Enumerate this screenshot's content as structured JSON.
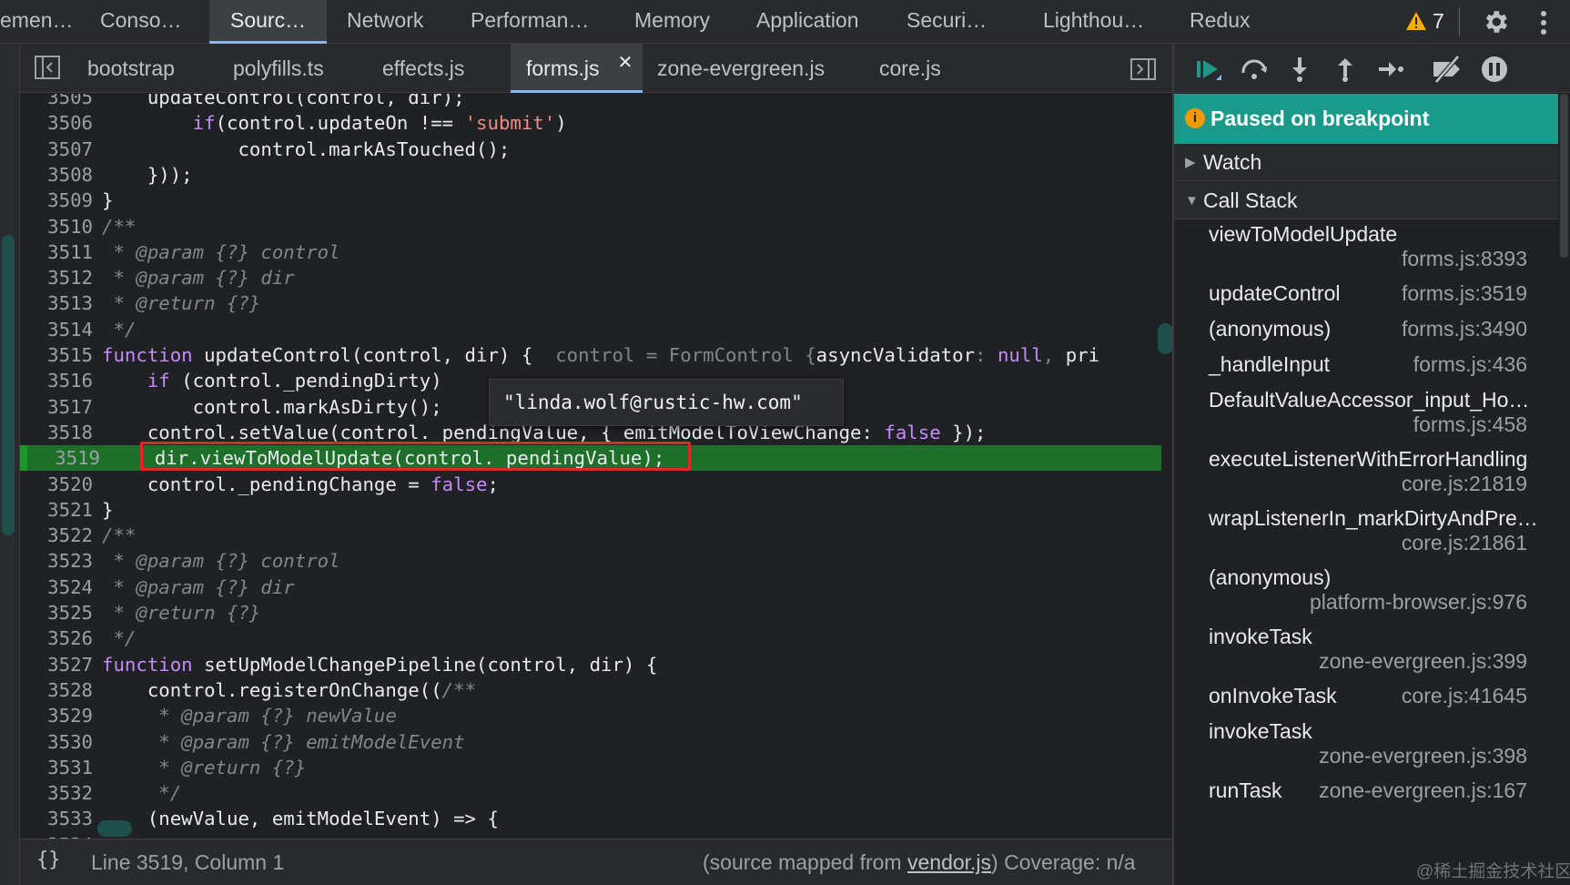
{
  "top_tabs": [
    "emen…",
    "Conso…",
    "Sourc…",
    "Network",
    "Performan…",
    "Memory",
    "Application",
    "Securi…",
    "Lighthou…",
    "Redux"
  ],
  "active_top_tab": "Sourc…",
  "warnings_count": "7",
  "file_tabs": [
    "bootstrap",
    "polyfills.ts",
    "effects.js",
    "forms.js",
    "zone-evergreen.js",
    "core.js"
  ],
  "active_file": "forms.js",
  "code_lines": [
    {
      "n": "3505",
      "tokens": [
        [
          "",
          "    updateControl(control, dir);"
        ]
      ]
    },
    {
      "n": "3506",
      "tokens": [
        [
          "kw",
          "        if"
        ],
        [
          "",
          "(control.updateOn !== "
        ],
        [
          "str",
          "'submit'"
        ],
        [
          "",
          ")"
        ]
      ]
    },
    {
      "n": "3507",
      "tokens": [
        [
          "",
          "            control.markAsTouched();"
        ]
      ]
    },
    {
      "n": "3508",
      "tokens": [
        [
          "",
          "    }));"
        ]
      ]
    },
    {
      "n": "3509",
      "tokens": [
        [
          "",
          "}"
        ]
      ]
    },
    {
      "n": "3510",
      "tokens": [
        [
          "cm",
          "/**"
        ]
      ]
    },
    {
      "n": "3511",
      "tokens": [
        [
          "cm",
          " * @param {?} control"
        ]
      ]
    },
    {
      "n": "3512",
      "tokens": [
        [
          "cm",
          " * @param {?} dir"
        ]
      ]
    },
    {
      "n": "3513",
      "tokens": [
        [
          "cm",
          " * @return {?}"
        ]
      ]
    },
    {
      "n": "3514",
      "tokens": [
        [
          "cm",
          " */"
        ]
      ]
    },
    {
      "n": "3515",
      "tokens": [
        [
          "kw",
          "function"
        ],
        [
          "",
          " updateControl(control, dir) {  "
        ],
        [
          "inl",
          "control = FormControl {"
        ],
        [
          "",
          "asyncValidator"
        ],
        [
          "inl",
          ": "
        ],
        [
          "inv",
          "null"
        ],
        [
          "inl",
          ", "
        ],
        [
          "",
          "pri"
        ]
      ]
    },
    {
      "n": "3516",
      "tokens": [
        [
          "kw",
          "    if"
        ],
        [
          "",
          " (control._pendingDirty)"
        ]
      ]
    },
    {
      "n": "3517",
      "tokens": [
        [
          "",
          "        control.markAsDirty();"
        ]
      ]
    },
    {
      "n": "3518",
      "tokens": [
        [
          "",
          "    control.setValue(control._pendingValue, { emitModelToViewChange: "
        ],
        [
          "lit",
          "false"
        ],
        [
          "",
          " });"
        ]
      ]
    },
    {
      "n": "3519",
      "tokens": [
        [
          "",
          "    dir.viewToModelUpdate(control._pendingValue);"
        ]
      ],
      "hl": true
    },
    {
      "n": "3520",
      "tokens": [
        [
          "",
          "    control._pendingChange = "
        ],
        [
          "lit",
          "false"
        ],
        [
          "",
          ";"
        ]
      ]
    },
    {
      "n": "3521",
      "tokens": [
        [
          "",
          "}"
        ]
      ]
    },
    {
      "n": "3522",
      "tokens": [
        [
          "cm",
          "/**"
        ]
      ]
    },
    {
      "n": "3523",
      "tokens": [
        [
          "cm",
          " * @param {?} control"
        ]
      ]
    },
    {
      "n": "3524",
      "tokens": [
        [
          "cm",
          " * @param {?} dir"
        ]
      ]
    },
    {
      "n": "3525",
      "tokens": [
        [
          "cm",
          " * @return {?}"
        ]
      ]
    },
    {
      "n": "3526",
      "tokens": [
        [
          "cm",
          " */"
        ]
      ]
    },
    {
      "n": "3527",
      "tokens": [
        [
          "kw",
          "function"
        ],
        [
          "",
          " setUpModelChangePipeline(control, dir) {"
        ]
      ]
    },
    {
      "n": "3528",
      "tokens": [
        [
          "",
          "    control.registerOnChange(("
        ],
        [
          "cm",
          "/**"
        ]
      ]
    },
    {
      "n": "3529",
      "tokens": [
        [
          "cm",
          "     * @param {?} newValue"
        ]
      ]
    },
    {
      "n": "3530",
      "tokens": [
        [
          "cm",
          "     * @param {?} emitModelEvent"
        ]
      ]
    },
    {
      "n": "3531",
      "tokens": [
        [
          "cm",
          "     * @return {?}"
        ]
      ]
    },
    {
      "n": "3532",
      "tokens": [
        [
          "cm",
          "     */"
        ]
      ]
    },
    {
      "n": "3533",
      "tokens": [
        [
          "",
          "    (newValue, emitModelEvent) => {"
        ]
      ]
    },
    {
      "n": "3534",
      "tokens": [
        [
          "",
          ""
        ]
      ]
    }
  ],
  "tooltip": "\"linda.wolf@rustic-hw.com\"",
  "status": {
    "position": "Line 3519, Column 1",
    "mapped_prefix": "(source mapped from ",
    "mapped_link": "vendor.js",
    "mapped_suffix": ")",
    "coverage": "Coverage: n/a"
  },
  "paused_text": "Paused on breakpoint",
  "sections": {
    "watch": "Watch",
    "call_stack": "Call Stack"
  },
  "call_stack": [
    {
      "fn": "viewToModelUpdate",
      "loc": "forms.js:8393",
      "wrap": true
    },
    {
      "fn": "updateControl",
      "loc": "forms.js:3519",
      "wrap": false
    },
    {
      "fn": "(anonymous)",
      "loc": "forms.js:3490",
      "wrap": false
    },
    {
      "fn": "_handleInput",
      "loc": "forms.js:436",
      "wrap": false
    },
    {
      "fn": "DefaultValueAccessor_input_Ho…",
      "loc": "forms.js:458",
      "wrap": true
    },
    {
      "fn": "executeListenerWithErrorHandling",
      "loc": "core.js:21819",
      "wrap": true
    },
    {
      "fn": "wrapListenerIn_markDirtyAndPre…",
      "loc": "core.js:21861",
      "wrap": true
    },
    {
      "fn": "(anonymous)",
      "loc": "platform-browser.js:976",
      "wrap": true
    },
    {
      "fn": "invokeTask",
      "loc": "zone-evergreen.js:399",
      "wrap": true
    },
    {
      "fn": "onInvokeTask",
      "loc": "core.js:41645",
      "wrap": false
    },
    {
      "fn": "invokeTask",
      "loc": "zone-evergreen.js:398",
      "wrap": true
    },
    {
      "fn": "runTask",
      "loc": "zone-evergreen.js:167",
      "wrap": false
    }
  ],
  "watermark": "@稀土掘金技术社区",
  "colors": {
    "accent": "#8ab4f8",
    "paused_bg": "#1a9a8a",
    "highlight_line": "#1e6f2a",
    "breakpoint_box": "#e52521"
  }
}
